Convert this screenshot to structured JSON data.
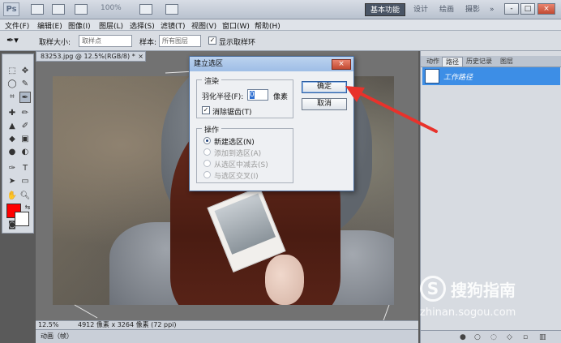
{
  "app": {
    "logo": "Ps",
    "zoom": "100%",
    "workspaces": [
      "基本功能",
      "设计",
      "绘画",
      "摄影"
    ],
    "more": "»",
    "window_buttons": [
      "-",
      "□",
      "×"
    ]
  },
  "menu": [
    "文件(F)",
    "编辑(E)",
    "图像(I)",
    "图层(L)",
    "选择(S)",
    "滤镜(T)",
    "视图(V)",
    "窗口(W)",
    "帮助(H)"
  ],
  "options": {
    "sample_size_label": "取样大小:",
    "sample_size_value": "取样点",
    "sample_label": "样本:",
    "sample_value": "所有图层",
    "show_ring_label": "显示取样环",
    "show_ring_checked": "✓"
  },
  "document": {
    "tab_title": "83253.jpg @ 12.5%(RGB/8) *",
    "tab_close": "×",
    "status_zoom": "12.5%",
    "status_info": "4912 像素 x 3264 像素 (72 ppi)",
    "bottom_tab": "动画（帧）"
  },
  "panel": {
    "tabs": [
      "动作",
      "路径",
      "历史记录",
      "图层"
    ],
    "active_tab": "路径",
    "path_item": "工作路径"
  },
  "dialog": {
    "title": "建立选区",
    "close": "×",
    "render_group": "渲染",
    "feather_label": "羽化半径(F):",
    "feather_value": "0",
    "feather_unit": "像素",
    "antialias_label": "消除锯齿(T)",
    "antialias_checked": "✓",
    "operation_group": "操作",
    "operations": [
      {
        "label": "新建选区(N)",
        "enabled": true,
        "selected": true
      },
      {
        "label": "添加到选区(A)",
        "enabled": false,
        "selected": false
      },
      {
        "label": "从选区中减去(S)",
        "enabled": false,
        "selected": false
      },
      {
        "label": "与选区交叉(I)",
        "enabled": false,
        "selected": false
      }
    ],
    "ok": "确定",
    "cancel": "取消"
  },
  "watermark": {
    "logo_letter": "S",
    "text": "搜狗指南",
    "url": "zhinan.sogou.com"
  },
  "colors": {
    "foreground": "#ff0000",
    "background": "#ffffff",
    "arrow": "#e8322b",
    "path_selected": "#3d8ee6"
  }
}
